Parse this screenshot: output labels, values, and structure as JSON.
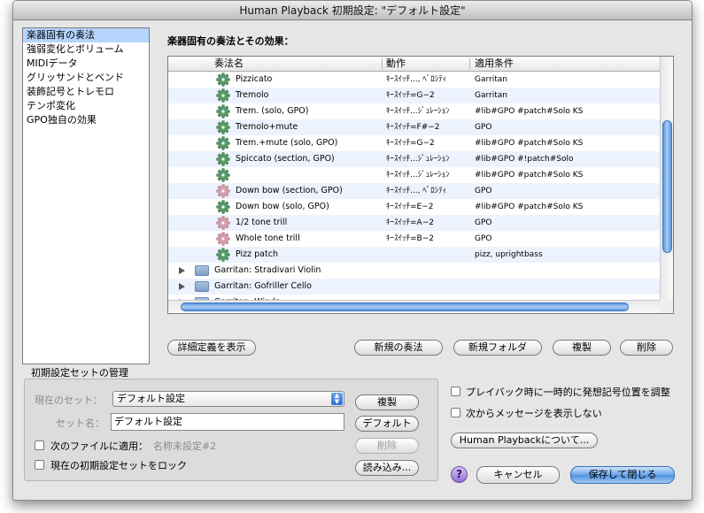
{
  "window": {
    "title": "Human Playback 初期設定: \"デフォルト設定\""
  },
  "categories": [
    {
      "label": "楽器固有の奏法",
      "selected": true
    },
    {
      "label": "強弱変化とボリューム",
      "selected": false
    },
    {
      "label": "MIDIデータ",
      "selected": false
    },
    {
      "label": "グリッサンドとベンド",
      "selected": false
    },
    {
      "label": "装飾記号とトレモロ",
      "selected": false
    },
    {
      "label": "テンポ変化",
      "selected": false
    },
    {
      "label": "GPO独自の効果",
      "selected": false
    }
  ],
  "main": {
    "section_title": "楽器固有の奏法とその効果：",
    "columns": {
      "name": "奏法名",
      "action": "動作",
      "condition": "適用条件"
    },
    "rows": [
      {
        "name": "Pizzicato",
        "action": "ｷｰｽｲｯﾁ..., ﾍﾞﾛｼﾃｨ",
        "condition": "Garritan",
        "icon": "gear-green-icon"
      },
      {
        "name": "Tremolo",
        "action": "ｷｰｽｲｯﾁ=G−2",
        "condition": "Garritan",
        "icon": "gear-green-icon"
      },
      {
        "name": "Trem. (solo, GPO)",
        "action": "ｷｰｽｲｯﾁ...ｼﾞｭﾚｰｼｮﾝ",
        "condition": "#lib#GPO #patch#Solo KS",
        "icon": "gear-green-icon"
      },
      {
        "name": "Tremolo+mute",
        "action": "ｷｰｽｲｯﾁ=F#−2",
        "condition": "GPO",
        "icon": "gear-green-icon"
      },
      {
        "name": "Trem.+mute (solo, GPO)",
        "action": "ｷｰｽｲｯﾁ=G−2",
        "condition": "#lib#GPO #patch#Solo KS",
        "icon": "gear-green-icon"
      },
      {
        "name": "Spiccato (section, GPO)",
        "action": "ｷｰｽｲｯﾁ...ｼﾞｭﾚｰｼｮﾝ",
        "condition": "#lib#GPO #!patch#Solo",
        "icon": "gear-green-icon"
      },
      {
        "name": "",
        "action": "ｷｰｽｲｯﾁ...ｼﾞｭﾚｰｼｮﾝ",
        "condition": "#lib#GPO #patch#Solo KS",
        "icon": "gear-green-icon"
      },
      {
        "name": "Down bow (section, GPO)",
        "action": "ｷｰｽｲｯﾁ..., ﾍﾞﾛｼﾃｨ",
        "condition": "GPO",
        "icon": "gear-pink-icon"
      },
      {
        "name": "Down bow (solo, GPO)",
        "action": "ｷｰｽｲｯﾁ=E−2",
        "condition": "#lib#GPO #patch#Solo KS",
        "icon": "gear-green-icon"
      },
      {
        "name": "1/2 tone trill",
        "action": "ｷｰｽｲｯﾁ=A−2",
        "condition": "GPO",
        "icon": "gear-pink-icon"
      },
      {
        "name": "Whole tone trill",
        "action": "ｷｰｽｲｯﾁ=B−2",
        "condition": "GPO",
        "icon": "gear-pink-icon"
      },
      {
        "name": "Pizz patch",
        "action": "",
        "condition": "pizz, uprightbass",
        "icon": "gear-green-icon"
      }
    ],
    "folders": [
      {
        "name": "Garritan: Stradivari Violin"
      },
      {
        "name": "Garritan: Gofriller Cello"
      },
      {
        "name": "Garritan: Winds"
      }
    ],
    "buttons": {
      "details": "詳細定義を表示",
      "new_technique": "新規の奏法",
      "new_folder": "新規フォルダ",
      "duplicate": "複製",
      "delete": "削除"
    }
  },
  "management": {
    "title": "初期設定セットの管理",
    "current_set_label": "現在のセット：",
    "current_set_value": "デフォルト設定",
    "set_name_label": "セット名：",
    "set_name_value": "デフォルト設定",
    "apply_next_label": "次のファイルに適用：",
    "apply_next_value": "名称未設定#2",
    "lock_label": "現在の初期設定セットをロック",
    "buttons": {
      "duplicate": "複製",
      "default": "デフォルト",
      "delete": "削除",
      "load": "読み込み..."
    }
  },
  "options": {
    "adjust_position": "プレイバック時に一時的に発想記号位置を調整",
    "dont_show": "次からメッセージを表示しない"
  },
  "footer": {
    "about": "Human Playbackについて...",
    "help": "?",
    "cancel": "キャンセル",
    "save_close": "保存して閉じる"
  },
  "colors": {
    "selection": "#b5d5ff",
    "alt_row": "#edf3fe",
    "accent_blue": "#4f92e2",
    "gear_green": "#5a9e6a",
    "gear_pink": "#d8a3b0"
  }
}
